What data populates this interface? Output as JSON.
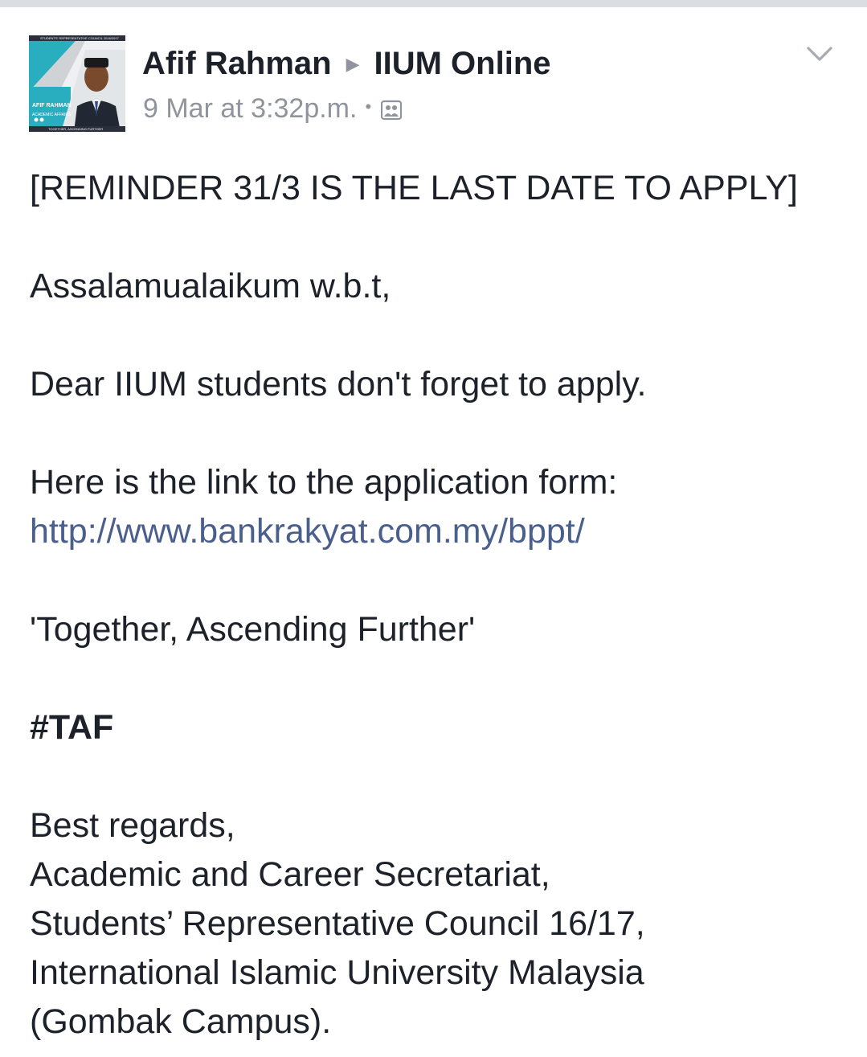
{
  "post": {
    "author": "Afif Rahman",
    "target": "IIUM Online",
    "timestamp": "9 Mar at 3:32p.m.",
    "separator": "•",
    "audience_icon": "group-audience-icon",
    "menu_icon": "chevron-down-icon",
    "avatar": {
      "banner_text": "STUDENTS' REPRESENTATIVE COUNCIL 2016/2017",
      "name_text": "AFIF RAHMAN",
      "role_text": "ACADEMIC AFFAIRS",
      "footer_text": "TOGETHER, ASCENDING FURTHER"
    },
    "body": {
      "headline": "[REMINDER 31/3 IS THE LAST DATE TO APPLY]",
      "greeting": "Assalamualaikum w.b.t,",
      "line1": "Dear IIUM students don't forget to apply.",
      "line2": "Here is the link to the application form:",
      "link": "http://www.bankrakyat.com.my/bppt/",
      "tagline": "'Together, Ascending Further'",
      "hashtag": "#TAF",
      "sign1": "Best regards,",
      "sign2": "Academic and Career Secretariat,",
      "sign3": "Students’ Representative Council 16/17,",
      "sign4": "International Islamic University Malaysia",
      "sign5": "(Gombak Campus)."
    }
  },
  "colors": {
    "text": "#1d2129",
    "meta": "#90949c",
    "link": "#4b5f8c",
    "avatar_teal": "#29aebf",
    "avatar_dark": "#2b2f3a"
  }
}
